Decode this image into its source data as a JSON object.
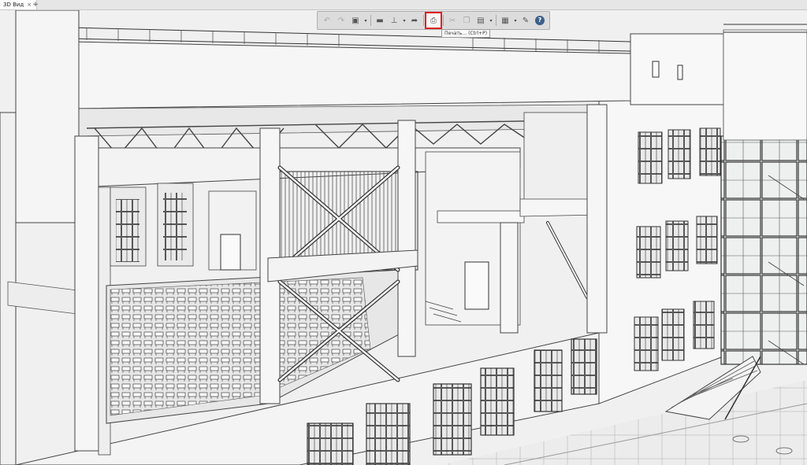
{
  "tab": {
    "title": "3D Вид",
    "close": "×",
    "add": "+"
  },
  "toolbar": {
    "buttons": [
      {
        "icon": "undo-icon",
        "glyph": "↶"
      },
      {
        "icon": "redo-icon",
        "glyph": "↷"
      },
      {
        "icon": "view-cube-icon",
        "glyph": "▣"
      },
      {
        "icon": "folder-icon",
        "glyph": "▬"
      },
      {
        "icon": "stamp-icon",
        "glyph": "⊥"
      },
      {
        "icon": "export-icon",
        "glyph": "➦"
      },
      {
        "icon": "printer-icon",
        "glyph": "⎙"
      },
      {
        "icon": "cut-icon",
        "glyph": "✂"
      },
      {
        "icon": "copy-icon",
        "glyph": "❐"
      },
      {
        "icon": "paste-icon",
        "glyph": "▤"
      },
      {
        "icon": "match-properties-icon",
        "glyph": "▦"
      },
      {
        "icon": "wrench-icon",
        "glyph": "✎"
      },
      {
        "icon": "help-icon",
        "glyph": "?"
      }
    ],
    "dropdown_glyph": "▾"
  },
  "tooltip": {
    "print": "Печать... (Ctrl+P)"
  }
}
